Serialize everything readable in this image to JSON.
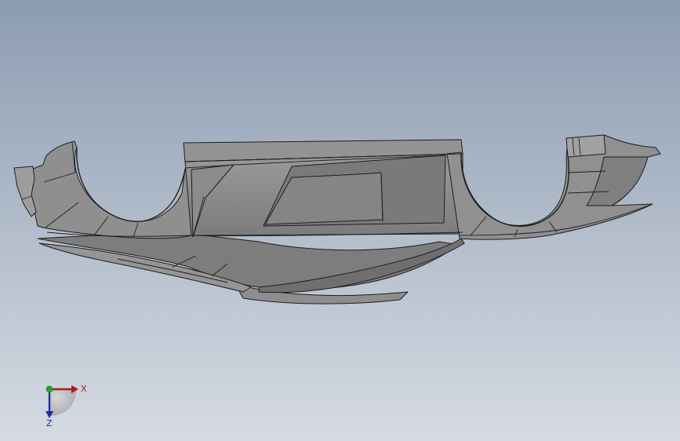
{
  "viewport": {
    "background_top": "#8c9cb1",
    "background_bottom": "#d6dbe3",
    "model_fill": "#8a8a8a",
    "model_fill_light": "#a3a3a3",
    "model_fill_dark": "#6e6e6e",
    "model_edge": "#1e1e1e",
    "model_icon": "car-body-shell-model"
  },
  "triad": {
    "x_label": "X",
    "z_label": "Z",
    "x_color": "#b01818",
    "y_color": "#1fa31f",
    "z_color": "#1e2e9c",
    "icon": "coordinate-triad-icon"
  }
}
